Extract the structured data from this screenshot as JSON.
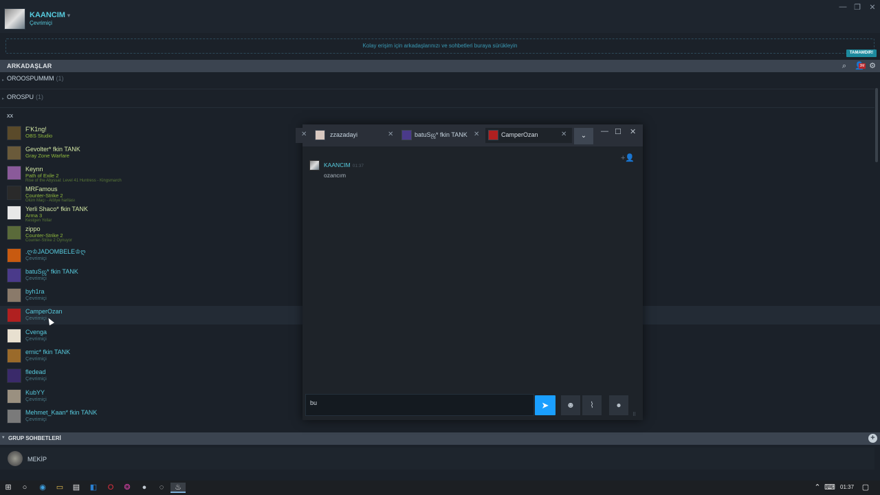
{
  "header": {
    "username": "KAANCIM",
    "status": "Çevrimiçi",
    "dropzone_text": "Kolay erişim için arkadaşlarınızı ve sohbetleri buraya sürükleyin",
    "done_label": "TAMAMDIR!"
  },
  "friends_bar": {
    "title": "ARKADAŞLAR",
    "badge": "3M"
  },
  "groups": [
    {
      "name": "OROOSPUMMM",
      "count": "(1)"
    },
    {
      "name": "OROSPU",
      "count": "(1)"
    }
  ],
  "section_label": "xx",
  "friends": [
    {
      "name": "F'K1ng!",
      "sub": "OBS Studio",
      "sub2": "",
      "state": "ingame",
      "color": "#5a4a2a"
    },
    {
      "name": "Gevolter* fkin TANK",
      "sub": "Gray Zone Warfare",
      "sub2": "",
      "state": "ingame",
      "color": "#6a5a3a"
    },
    {
      "name": "Keynn",
      "sub": "Path of Exile 2",
      "sub2": "Rise of the Abyssal: Level 41 Huntress - Kingsmarch",
      "state": "ingame",
      "color": "#8a5a9a"
    },
    {
      "name": "MRFamous",
      "sub": "Counter-Strike 2",
      "sub2": "Ölüm Maçı - Atölye haritası",
      "state": "ingame",
      "color": "#2a2a2a"
    },
    {
      "name": "Yerli Shaco* fkin TANK",
      "sub": "Arma 3",
      "sub2": "Kestgen Yollar",
      "state": "ingame",
      "color": "#e8e8e8"
    },
    {
      "name": "zippo",
      "sub": "Counter-Strike 2",
      "sub2": "Counter-Strike 2 Oynuyor",
      "state": "ingame",
      "color": "#5a6a3a"
    },
    {
      "name": ".ღ♔JADOMBELE♔ღ",
      "sub": "Çevrimiçi",
      "sub2": "",
      "state": "online",
      "color": "#c85a10"
    },
    {
      "name": "batuSஜ* fkin TANK",
      "sub": "Çevrimiçi",
      "sub2": "",
      "state": "online",
      "color": "#4a3a8a"
    },
    {
      "name": "byh1ra",
      "sub": "Çevrimiçi",
      "sub2": "",
      "state": "online",
      "color": "#8a7a6a"
    },
    {
      "name": "CamperOzan",
      "sub": "Çevrimiçi",
      "sub2": "",
      "state": "online",
      "color": "#b02020"
    },
    {
      "name": "Cvenga",
      "sub": "Çevrimiçi",
      "sub2": "",
      "state": "online",
      "color": "#e8e0d0"
    },
    {
      "name": "ernic* fkin TANK",
      "sub": "Çevrimiçi",
      "sub2": "",
      "state": "online",
      "color": "#9a6a2a"
    },
    {
      "name": "fledead",
      "sub": "Çevrimiçi",
      "sub2": "",
      "state": "online",
      "color": "#3a2a6a"
    },
    {
      "name": "KubYY",
      "sub": "Çevrimiçi",
      "sub2": "",
      "state": "online",
      "color": "#9a9080"
    },
    {
      "name": "Mehmet_Kaan* fkin TANK",
      "sub": "Çevrimiçi",
      "sub2": "",
      "state": "online",
      "color": "#7a7a7a"
    }
  ],
  "group_chats": {
    "title": "GRUP SOHBETLERİ",
    "items": [
      {
        "name": "MEKİP"
      }
    ]
  },
  "chat": {
    "tabs": [
      {
        "name": "zzazadayi",
        "color": "#d8c8c0"
      },
      {
        "name": "batuSஜ* fkin TANK",
        "color": "#4a3a8a"
      },
      {
        "name": "CamperOzan",
        "color": "#b02020"
      }
    ],
    "message": {
      "author": "KAANCIM",
      "time": "01:37",
      "text": "ozancım"
    },
    "input_value": "bu"
  },
  "taskbar": {
    "clock": "01:37"
  }
}
